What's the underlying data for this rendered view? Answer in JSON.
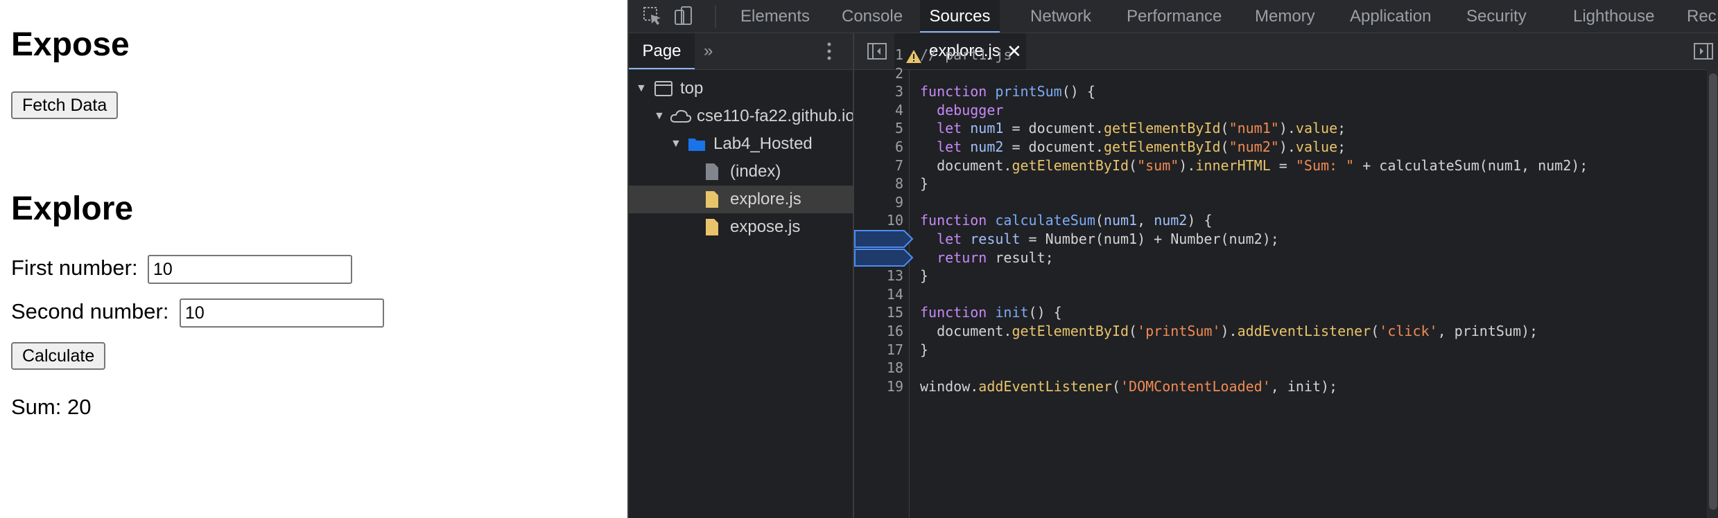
{
  "webpage": {
    "expose_heading": "Expose",
    "fetch_button": "Fetch Data",
    "explore_heading": "Explore",
    "first_label": "First number:",
    "first_value": "10",
    "second_label": "Second number:",
    "second_value": "10",
    "calculate_button": "Calculate",
    "sum_text": "Sum: 20"
  },
  "devtools": {
    "tabs": [
      "Elements",
      "Console",
      "Sources",
      "Network",
      "Performance",
      "Memory",
      "Application",
      "Security",
      "Lighthouse",
      "Rec"
    ],
    "active_tab": "Sources",
    "nav": {
      "page_tab": "Page",
      "more": "»",
      "tree": [
        {
          "label": "top",
          "icon": "frame-icon"
        },
        {
          "label": "cse110-fa22.github.io",
          "icon": "cloud-icon"
        },
        {
          "label": "Lab4_Hosted",
          "icon": "folder-icon"
        },
        {
          "label": "(index)",
          "icon": "file-icon"
        },
        {
          "label": "explore.js",
          "icon": "js-file-icon",
          "selected": true
        },
        {
          "label": "expose.js",
          "icon": "js-file-icon"
        }
      ]
    },
    "editor": {
      "file_tab": "explore.js",
      "breakpoint_lines": [
        11,
        12
      ],
      "lines": [
        "// part1.js",
        "",
        "function printSum() {",
        "  debugger",
        "  let num1 = document.getElementById(\"num1\").value;",
        "  let num2 = document.getElementById(\"num2\").value;",
        "  document.getElementById(\"sum\").innerHTML = \"Sum: \" + calculateSum(num1, num2);",
        "}",
        "",
        "function calculateSum(num1, num2) {",
        "  let result = Number(num1) + Number(num2);",
        "  return result;",
        "}",
        "",
        "function init() {",
        "  document.getElementById('printSum').addEventListener('click', printSum);",
        "}",
        "",
        "window.addEventListener('DOMContentLoaded', init);"
      ]
    }
  }
}
